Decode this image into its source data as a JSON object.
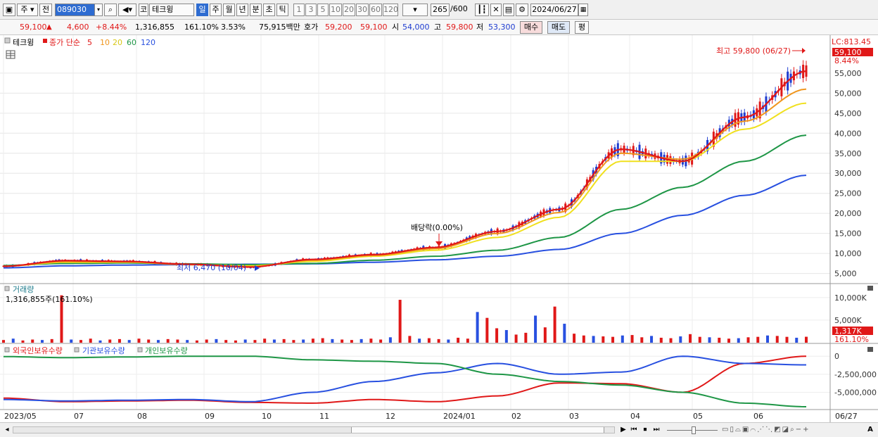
{
  "toolbar": {
    "market": "주",
    "prev": "전",
    "code": "089030",
    "market_code": "코",
    "stock_name": "테크윙",
    "periods": [
      "일",
      "주",
      "월",
      "년",
      "분",
      "초",
      "틱"
    ],
    "active_period": "일",
    "intervals": [
      "1",
      "3",
      "5",
      "10",
      "20",
      "30",
      "60",
      "120"
    ],
    "count": "265",
    "total": "/600",
    "date": "2024/06/27"
  },
  "infobar": {
    "price": "59,100",
    "up_arrow": "▲",
    "change": "4,600",
    "change_pct": "+8.44%",
    "volume": "1,316,855",
    "vol_ratio": "161.10%",
    "turnover": "3.53%",
    "amount": "75,915백만",
    "quote_label": "호가",
    "ask": "59,200",
    "bid": "59,100",
    "open_label": "시",
    "open": "54,000",
    "high_label": "고",
    "high": "59,800",
    "low_label": "저",
    "low": "53,300",
    "buy": "매수",
    "sell": "매도",
    "avg": "평"
  },
  "price_panel": {
    "legend_name": "테크윙",
    "legend_type": "종가 단순",
    "ma_labels": [
      "5",
      "10",
      "20",
      "60",
      "120"
    ],
    "ma_colors": [
      "#e01818",
      "#f0961e",
      "#f0e01e",
      "#1e9646",
      "#2850e0"
    ],
    "lc_label": "LC:813.45",
    "last_price": "59,100",
    "last_pct": "8.44%",
    "high_annot": "최고 59,800 (06/27)",
    "low_annot": "최저 6,470 (10/04)",
    "dividend_annot": "배당락(0.00%)"
  },
  "volume_panel": {
    "title": "거래량",
    "current": "1,316,855주(161.10%)",
    "last_label": "1,317K",
    "last_pct": "161.10%"
  },
  "holding_panel": {
    "series": [
      "외국인보유수량",
      "기관보유수량",
      "개인보유수량"
    ]
  },
  "x_axis_labels": [
    "2023/05",
    "07",
    "08",
    "09",
    "10",
    "11",
    "12",
    "2024/01",
    "02",
    "03",
    "04",
    "05",
    "06",
    "06/27"
  ],
  "chart_data": [
    {
      "type": "line",
      "title": "테크윙",
      "y_ticks": [
        "5,000",
        "10,000",
        "15,000",
        "20,000",
        "25,000",
        "30,000",
        "35,000",
        "40,000",
        "45,000",
        "50,000",
        "55,000"
      ],
      "ylim": [
        3000,
        62000
      ],
      "x": [
        "2023/05",
        "07",
        "08",
        "09",
        "10",
        "11",
        "12",
        "2024/01",
        "02",
        "03",
        "04",
        "05",
        "06",
        "06/27"
      ],
      "series": [
        {
          "name": "5",
          "values": [
            6800,
            8200,
            8000,
            7300,
            6600,
            8500,
            9700,
            11500,
            15500,
            21000,
            36000,
            33000,
            44000,
            55500
          ]
        },
        {
          "name": "10",
          "values": [
            6800,
            8000,
            7900,
            7200,
            6700,
            8300,
            9500,
            11200,
            15000,
            20200,
            35000,
            33500,
            43000,
            51000
          ]
        },
        {
          "name": "20",
          "values": [
            6800,
            7800,
            7800,
            7200,
            6900,
            8000,
            9300,
            10800,
            14000,
            19000,
            33000,
            33000,
            41000,
            47500
          ]
        },
        {
          "name": "60",
          "values": [
            7000,
            7500,
            7600,
            7400,
            7200,
            7500,
            8300,
            9300,
            10800,
            14000,
            21000,
            26500,
            33000,
            39500
          ]
        },
        {
          "name": "120",
          "values": [
            6400,
            6900,
            7100,
            7200,
            7300,
            7400,
            7800,
            8400,
            9300,
            11000,
            15000,
            19500,
            24500,
            29500
          ]
        }
      ]
    },
    {
      "type": "bar",
      "title": "거래량",
      "y_ticks": [
        "5,000K",
        "10,000K"
      ],
      "ylim": [
        0,
        12000
      ],
      "values": [
        600,
        900,
        500,
        700,
        600,
        800,
        10500,
        700,
        600,
        900,
        500,
        700,
        800,
        600,
        900,
        700,
        600,
        800,
        700,
        600,
        500,
        700,
        800,
        600,
        500,
        700,
        600,
        900,
        700,
        800,
        600,
        700,
        900,
        1000,
        800,
        700,
        600,
        800,
        900,
        700,
        1200,
        9500,
        1500,
        900,
        1000,
        800,
        700,
        1100,
        900,
        6800,
        5500,
        3200,
        2800,
        1800,
        2200,
        6000,
        3400,
        8000,
        4200,
        2000,
        1600,
        1500,
        1400,
        1300,
        1600,
        1700,
        1200,
        1500,
        1100,
        1000,
        1400,
        1900,
        1300,
        1200,
        1100,
        900,
        1000,
        1200,
        1300,
        1600,
        1500,
        1300,
        1100,
        1317
      ]
    },
    {
      "type": "line",
      "title": "보유수량",
      "y_ticks": [
        "0",
        "-2,500,000",
        "-5,000,000"
      ],
      "ylim": [
        -7000000,
        800000
      ],
      "x": [
        "2023/05",
        "07",
        "08",
        "09",
        "10",
        "11",
        "12",
        "2024/01",
        "02",
        "03",
        "04",
        "05",
        "06",
        "06/27"
      ],
      "series": [
        {
          "name": "외국인보유수량",
          "values": [
            -5800000,
            -6300000,
            -6200000,
            -6100000,
            -6400000,
            -6500000,
            -6000000,
            -6300000,
            -5500000,
            -3700000,
            -3800000,
            -5000000,
            -1000000,
            0
          ]
        },
        {
          "name": "기관보유수량",
          "values": [
            -6000000,
            -6200000,
            -6100000,
            -6000000,
            -6300000,
            -5000000,
            -3500000,
            -2300000,
            -1000000,
            -2500000,
            -2200000,
            0,
            -1000000,
            -1200000
          ]
        },
        {
          "name": "개인보유수량",
          "values": [
            -50000,
            -200000,
            -100000,
            0,
            0,
            -500000,
            -700000,
            -1000000,
            -2500000,
            -3500000,
            -4000000,
            -5000000,
            -6500000,
            -7000000
          ]
        }
      ]
    }
  ],
  "statusbar": {
    "controls": [
      "◀",
      "▶",
      "⏮",
      "⏹",
      "⏭"
    ]
  }
}
